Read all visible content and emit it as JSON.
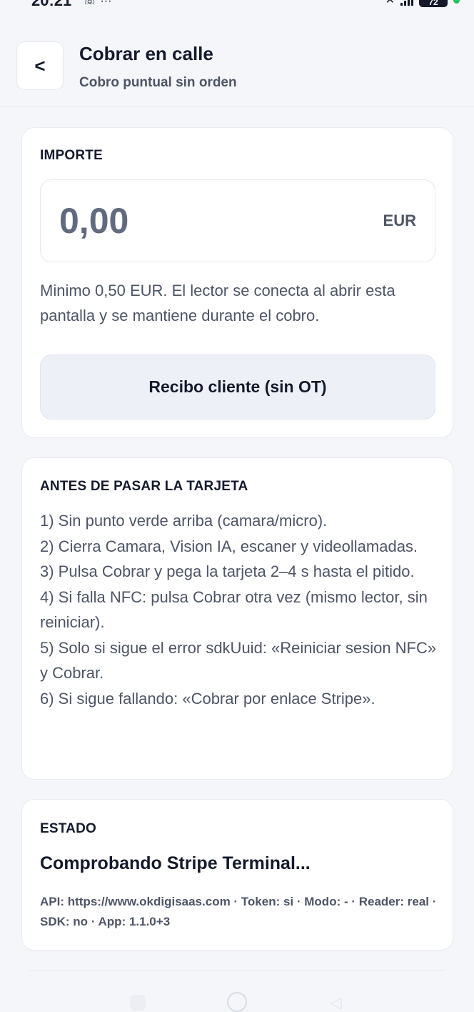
{
  "status_bar": {
    "time": "20:21",
    "left_icons": "☏ ···",
    "battery": "72",
    "icons": [
      "missed-call-icon",
      "more-dots-icon",
      "mute-icon",
      "signal-icon",
      "battery-icon"
    ]
  },
  "header": {
    "back_label": "<",
    "title": "Cobrar en calle",
    "subtitle": "Cobro puntual sin orden"
  },
  "amount_card": {
    "label": "IMPORTE",
    "value": "0,00",
    "currency": "EUR",
    "note": "Minimo 0,50 EUR. El lector se conecta al abrir esta pantalla y se mantiene durante el cobro.",
    "receipt_button": "Recibo cliente (sin OT)"
  },
  "tips_card": {
    "label": "ANTES DE PASAR LA TARJETA",
    "items": [
      "1) Sin punto verde arriba (camara/micro).",
      "2) Cierra Camara, Vision IA, escaner y videollamadas.",
      "3) Pulsa Cobrar y pega la tarjeta 2–4 s hasta el pitido.",
      "4) Si falla NFC: pulsa Cobrar otra vez (mismo lector, sin reiniciar).",
      "5) Solo si sigue el error sdkUuid: «Reiniciar sesion NFC» y Cobrar.",
      "6) Si sigue fallando: «Cobrar por enlace Stripe»."
    ]
  },
  "status_card": {
    "label": "ESTADO",
    "text": "Comprobando Stripe Terminal...",
    "meta": "API: https://www.okdigisaas.com · Token: si · Modo: - · Reader: real · SDK: no · App: 1.1.0+3"
  },
  "colors": {
    "background": "#f4f6fa",
    "card": "#ffffff",
    "primary_text": "#141a2b",
    "secondary_text": "#4d5566",
    "button_bg": "#eef0f8",
    "battery_dot": "#22c55e"
  }
}
